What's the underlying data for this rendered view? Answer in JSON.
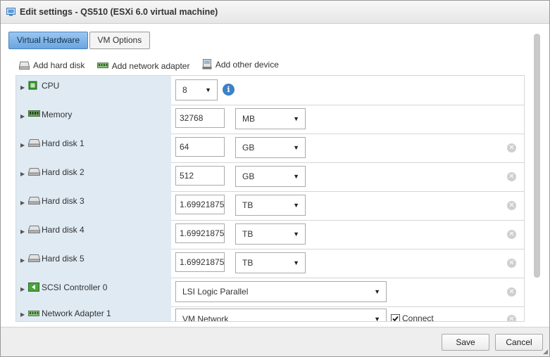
{
  "dialog": {
    "title": "Edit settings - QS510 (ESXi 6.0 virtual machine)"
  },
  "tabs": [
    {
      "label": "Virtual Hardware",
      "active": true
    },
    {
      "label": "VM Options",
      "active": false
    }
  ],
  "toolbar": {
    "add_hard_disk": "Add hard disk",
    "add_network_adapter": "Add network adapter",
    "add_other_device": "Add other device"
  },
  "rows": {
    "cpu": {
      "label": "CPU",
      "value": "8"
    },
    "memory": {
      "label": "Memory",
      "value": "32768",
      "unit": "MB"
    },
    "hard_disk_1": {
      "label": "Hard disk 1",
      "value": "64",
      "unit": "GB"
    },
    "hard_disk_2": {
      "label": "Hard disk 2",
      "value": "512",
      "unit": "GB"
    },
    "hard_disk_3": {
      "label": "Hard disk 3",
      "value": "1.6992187500",
      "unit": "TB"
    },
    "hard_disk_4": {
      "label": "Hard disk 4",
      "value": "1.6992187500",
      "unit": "TB"
    },
    "hard_disk_5": {
      "label": "Hard disk 5",
      "value": "1.6992187500",
      "unit": "TB"
    },
    "scsi_controller_0": {
      "label": "SCSI Controller 0",
      "value": "LSI Logic Parallel"
    },
    "network_adapter_1": {
      "label": "Network Adapter 1",
      "value": "VM Network",
      "connect_label": "Connect",
      "connected": true
    }
  },
  "footer": {
    "save_label": "Save",
    "cancel_label": "Cancel"
  },
  "icons": {
    "title": "vm-settings-icon",
    "cpu": "cpu-icon",
    "memory": "memory-icon",
    "hard_disk": "hard-disk-icon",
    "scsi": "scsi-controller-icon",
    "network": "network-adapter-icon",
    "info": "info-icon",
    "remove": "remove-icon"
  },
  "colors": {
    "active_tab": "#6aa6e0",
    "label_cell_bg": "#dfeaf3",
    "info_blue": "#3b82c6",
    "cpu_green": "#3a9a2c"
  }
}
